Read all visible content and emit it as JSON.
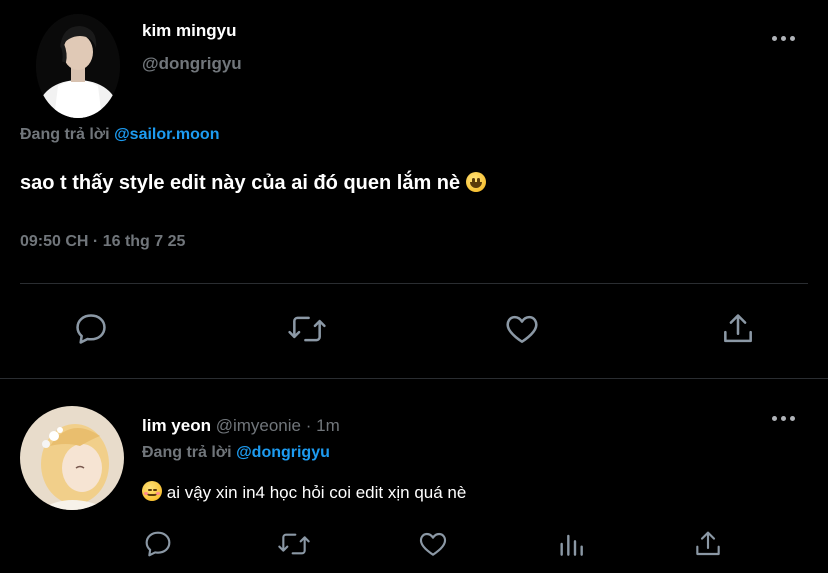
{
  "tweet": {
    "author_name": "kim mingyu",
    "author_handle": "@dongrigyu",
    "replying_prefix": "Đang trả lời",
    "replying_to": "@sailor.moon",
    "text": "sao t thấy style edit này của ai đó quen lắm nè",
    "timestamp": "09:50 CH · 16 thg 7 25",
    "actions": [
      "reply-icon",
      "retweet-icon",
      "like-icon",
      "share-icon"
    ]
  },
  "reply": {
    "author_name": "lim yeon",
    "author_handle": "@imyeonie",
    "separator": "·",
    "time": "1m",
    "replying_prefix": "Đang trả lời",
    "replying_to": "@dongrigyu",
    "text": "ai vậy xin in4 học hỏi coi edit xịn quá nè",
    "actions": [
      "reply-icon",
      "retweet-icon",
      "like-icon",
      "views-icon",
      "share-icon"
    ]
  },
  "colors": {
    "background": "#000000",
    "primary_text": "#ffffff",
    "secondary_text": "#71767b",
    "link": "#1d9bf0",
    "icon": "#8b98a5",
    "divider": "#2a2d31"
  }
}
